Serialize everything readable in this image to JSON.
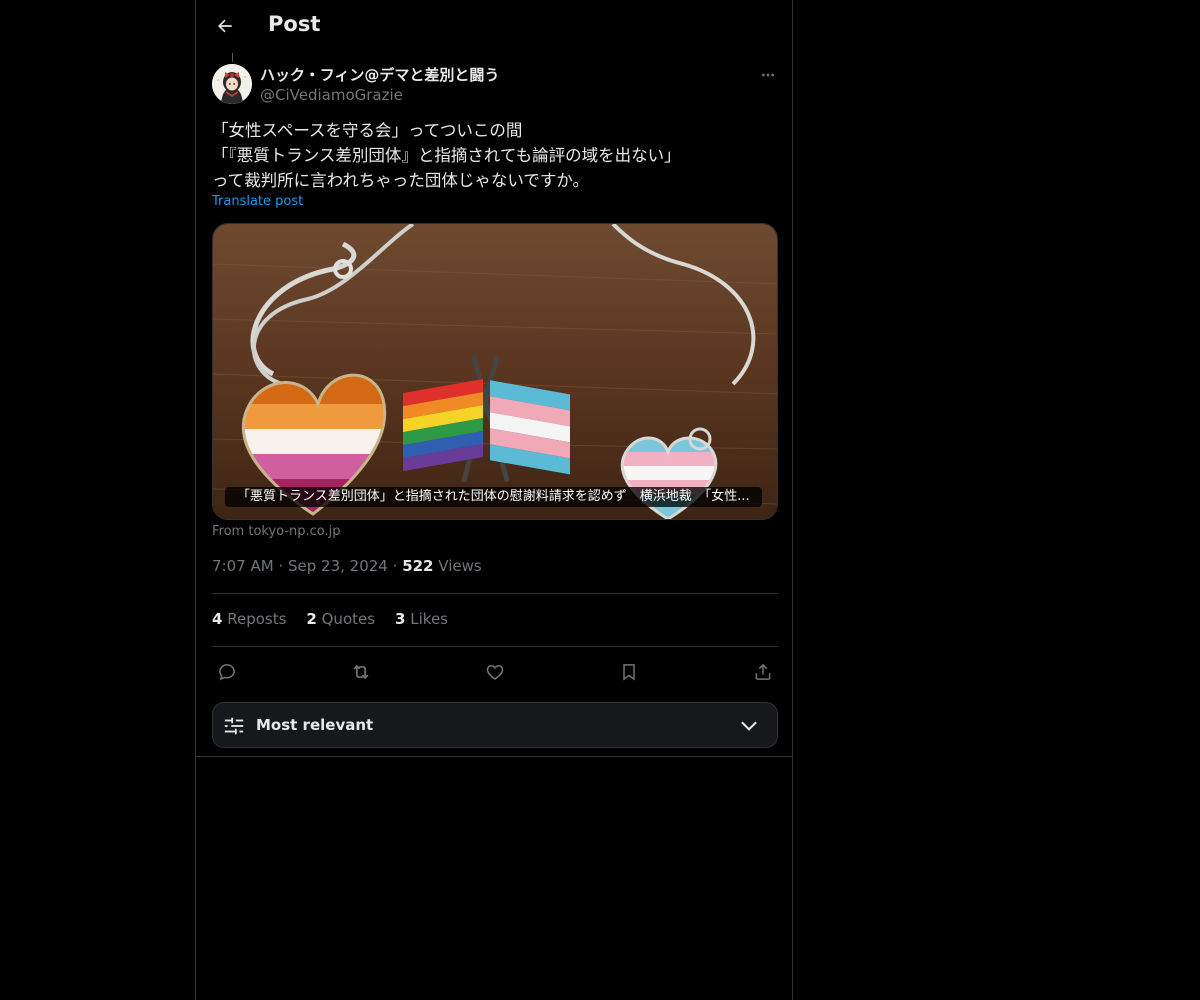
{
  "header": {
    "title": "Post",
    "back_icon": "arrow-left-icon"
  },
  "post": {
    "author_name": "ハック・フィン@デマと差別と闘う",
    "author_handle": "@CiVediamoGrazie",
    "text_lines": [
      "「女性スペースを守る会」ってついこの間",
      "「『悪質トランス差別団体』と指摘されても論評の域を出ない」",
      "って裁判所に言われちゃった団体じゃないですか。"
    ],
    "translate_label": "Translate post",
    "card": {
      "caption": "「悪質トランス差別団体」と指摘された団体の慰謝料請求を認めず　横浜地裁　「女性...",
      "source": "From tokyo-np.co.jp"
    },
    "time": "7:07 AM",
    "date": "Sep 23, 2024",
    "views_count": "522",
    "views_label": "Views",
    "separator": "·"
  },
  "stats": {
    "reposts_count": "4",
    "reposts_label": "Reposts",
    "quotes_count": "2",
    "quotes_label": "Quotes",
    "likes_count": "3",
    "likes_label": "Likes"
  },
  "actions": [
    "reply-icon",
    "repost-icon",
    "like-icon",
    "bookmark-icon",
    "share-icon"
  ],
  "sort": {
    "label": "Most relevant",
    "icon": "sliders-icon",
    "chevron": "chevron-down-icon"
  },
  "colors": {
    "background": "#000000",
    "text": "#e7e9ea",
    "muted": "#71767b",
    "link": "#1d9bf0",
    "border": "#2f3336"
  }
}
